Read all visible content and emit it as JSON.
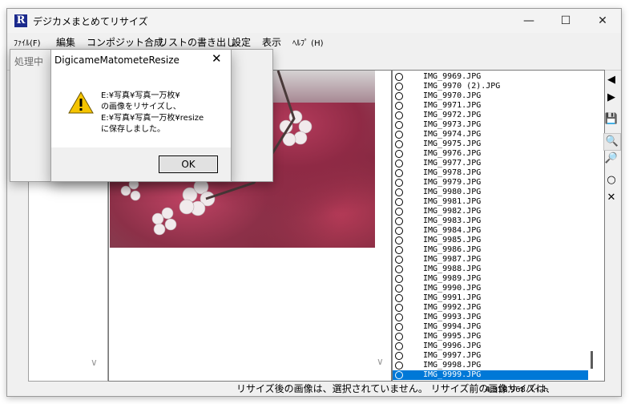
{
  "window": {
    "title": "デジカメまとめてリサイズ",
    "logo": "R"
  },
  "title_buttons": {
    "minimize": "—",
    "maximize": "☐",
    "close": "✕"
  },
  "menu": {
    "items": [
      {
        "label": "ﾌｧｲﾙ(F)",
        "small": true
      },
      {
        "label": "編集"
      },
      {
        "label": "コンポジット合成"
      },
      {
        "label": "リストの書き出し"
      },
      {
        "label": "設定"
      },
      {
        "label": "表示"
      },
      {
        "label": "ﾍﾙﾌﾟ (H)",
        "small": true
      }
    ]
  },
  "processing": {
    "label": "処理中"
  },
  "file_list": {
    "items": [
      "IMG_9969.JPG",
      "IMG_9970 (2).JPG",
      "IMG_9970.JPG",
      "IMG_9971.JPG",
      "IMG_9972.JPG",
      "IMG_9973.JPG",
      "IMG_9974.JPG",
      "IMG_9975.JPG",
      "IMG_9976.JPG",
      "IMG_9977.JPG",
      "IMG_9978.JPG",
      "IMG_9979.JPG",
      "IMG_9980.JPG",
      "IMG_9981.JPG",
      "IMG_9982.JPG",
      "IMG_9983.JPG",
      "IMG_9984.JPG",
      "IMG_9985.JPG",
      "IMG_9986.JPG",
      "IMG_9987.JPG",
      "IMG_9988.JPG",
      "IMG_9989.JPG",
      "IMG_9990.JPG",
      "IMG_9991.JPG",
      "IMG_9992.JPG",
      "IMG_9993.JPG",
      "IMG_9994.JPG",
      "IMG_9995.JPG",
      "IMG_9996.JPG",
      "IMG_9997.JPG",
      "IMG_9998.JPG",
      "IMG_9999.JPG"
    ],
    "selected_index": 31,
    "selection_color": "#0078d7"
  },
  "side_tools": [
    "prev-icon",
    "next-icon",
    "save-icon",
    "zoom-in-icon",
    "zoom-out-icon",
    "circle-icon",
    "cross-icon"
  ],
  "status": {
    "message": "リサイズ後の画像は、選択されていません。 リサイズ前の画像サイズは、",
    "bytes": "4,318,968バイト"
  },
  "dialog": {
    "title": "DigicameMatometeResize",
    "close": "✕",
    "message_lines": [
      "E:¥写真¥写真一万枚¥",
      "の画像をリサイズし、",
      "E:¥写真¥写真一万枚¥resize",
      "に保存しました。"
    ],
    "ok_label": "OK"
  }
}
